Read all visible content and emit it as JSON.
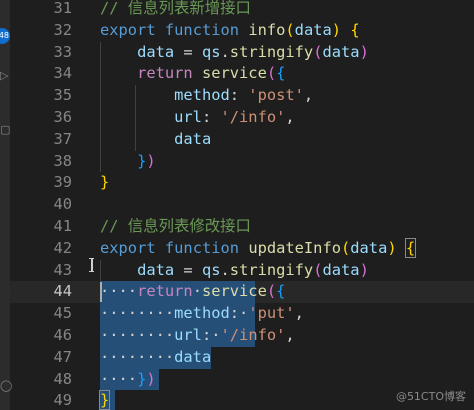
{
  "activity_bar": {
    "badge": "48",
    "icons": [
      "run-debug-icon",
      "extensions-icon",
      "account-icon"
    ]
  },
  "editor": {
    "current_line": 44,
    "lines": [
      {
        "number": "31",
        "tokens": [
          {
            "t": "// 信息列表新增接口",
            "c": "cmt"
          }
        ]
      },
      {
        "number": "32",
        "tokens": [
          {
            "t": "export",
            "c": "kw"
          },
          {
            "t": " "
          },
          {
            "t": "function",
            "c": "kw"
          },
          {
            "t": " "
          },
          {
            "t": "info",
            "c": "fn"
          },
          {
            "t": "(",
            "c": "b1"
          },
          {
            "t": "data",
            "c": "vr"
          },
          {
            "t": ")",
            "c": "b1"
          },
          {
            "t": " "
          },
          {
            "t": "{",
            "c": "b1"
          }
        ]
      },
      {
        "number": "33",
        "tokens": [
          {
            "t": "    "
          },
          {
            "t": "data",
            "c": "vr"
          },
          {
            "t": " = "
          },
          {
            "t": "qs",
            "c": "vr"
          },
          {
            "t": "."
          },
          {
            "t": "stringify",
            "c": "fn"
          },
          {
            "t": "(",
            "c": "b2"
          },
          {
            "t": "data",
            "c": "vr"
          },
          {
            "t": ")",
            "c": "b2"
          }
        ]
      },
      {
        "number": "34",
        "tokens": [
          {
            "t": "    "
          },
          {
            "t": "return",
            "c": "ctl"
          },
          {
            "t": " "
          },
          {
            "t": "service",
            "c": "fn"
          },
          {
            "t": "(",
            "c": "b2"
          },
          {
            "t": "{",
            "c": "b3"
          }
        ]
      },
      {
        "number": "35",
        "tokens": [
          {
            "t": "        "
          },
          {
            "t": "method",
            "c": "vr"
          },
          {
            "t": ": "
          },
          {
            "t": "'post'",
            "c": "str"
          },
          {
            "t": ","
          }
        ]
      },
      {
        "number": "36",
        "tokens": [
          {
            "t": "        "
          },
          {
            "t": "url",
            "c": "vr"
          },
          {
            "t": ": "
          },
          {
            "t": "'/info'",
            "c": "str"
          },
          {
            "t": ","
          }
        ]
      },
      {
        "number": "37",
        "tokens": [
          {
            "t": "        "
          },
          {
            "t": "data",
            "c": "vr"
          }
        ]
      },
      {
        "number": "38",
        "tokens": [
          {
            "t": "    "
          },
          {
            "t": "}",
            "c": "b3"
          },
          {
            "t": ")",
            "c": "b2"
          }
        ]
      },
      {
        "number": "39",
        "tokens": [
          {
            "t": "}",
            "c": "b1"
          }
        ]
      },
      {
        "number": "40",
        "tokens": []
      },
      {
        "number": "41",
        "tokens": [
          {
            "t": "// 信息列表修改接口",
            "c": "cmt"
          }
        ]
      },
      {
        "number": "42",
        "tokens": [
          {
            "t": "export",
            "c": "kw"
          },
          {
            "t": " "
          },
          {
            "t": "function",
            "c": "kw"
          },
          {
            "t": " "
          },
          {
            "t": "updateInfo",
            "c": "fn"
          },
          {
            "t": "(",
            "c": "b1"
          },
          {
            "t": "data",
            "c": "vr"
          },
          {
            "t": ")",
            "c": "b1"
          },
          {
            "t": " "
          },
          {
            "t": "{",
            "c": "b1",
            "m": true
          }
        ]
      },
      {
        "number": "43",
        "tokens": [
          {
            "t": "    "
          },
          {
            "t": "data",
            "c": "vr"
          },
          {
            "t": " = "
          },
          {
            "t": "qs",
            "c": "vr"
          },
          {
            "t": "."
          },
          {
            "t": "stringify",
            "c": "fn"
          },
          {
            "t": "(",
            "c": "b2"
          },
          {
            "t": "data",
            "c": "vr"
          },
          {
            "t": ")",
            "c": "b2"
          }
        ]
      },
      {
        "number": "44",
        "tokens": [
          {
            "t": "    ",
            "w": true
          },
          {
            "t": "return",
            "c": "ctl"
          },
          {
            "t": " ",
            "w": true
          },
          {
            "t": "service",
            "c": "fn"
          },
          {
            "t": "(",
            "c": "b2"
          },
          {
            "t": "{",
            "c": "b3"
          }
        ]
      },
      {
        "number": "45",
        "tokens": [
          {
            "t": "        ",
            "w": true
          },
          {
            "t": "method",
            "c": "vr"
          },
          {
            "t": ":"
          },
          {
            "t": " ",
            "w": true
          },
          {
            "t": "'put'",
            "c": "str"
          },
          {
            "t": ","
          }
        ]
      },
      {
        "number": "46",
        "tokens": [
          {
            "t": "        ",
            "w": true
          },
          {
            "t": "url",
            "c": "vr"
          },
          {
            "t": ":"
          },
          {
            "t": " ",
            "w": true
          },
          {
            "t": "'/info'",
            "c": "str"
          },
          {
            "t": ","
          }
        ]
      },
      {
        "number": "47",
        "tokens": [
          {
            "t": "        ",
            "w": true
          },
          {
            "t": "data",
            "c": "vr"
          }
        ]
      },
      {
        "number": "48",
        "tokens": [
          {
            "t": "    ",
            "w": true
          },
          {
            "t": "}",
            "c": "b3"
          },
          {
            "t": ")",
            "c": "b2"
          }
        ]
      },
      {
        "number": "49",
        "tokens": [
          {
            "t": "}",
            "c": "b1",
            "m": true
          }
        ]
      }
    ]
  },
  "selection": {
    "from_line": "44",
    "to_line": "49",
    "columns": [
      {
        "line": "44",
        "chars": 17
      },
      {
        "line": "45",
        "chars": 17
      },
      {
        "line": "46",
        "chars": 17
      },
      {
        "line": "47",
        "chars": 12
      },
      {
        "line": "48",
        "chars": 6
      },
      {
        "line": "49",
        "chars": 1
      }
    ]
  },
  "watermark": "@51CTO博客",
  "colors": {
    "background": "#1e1e1e",
    "selection": "#264f78",
    "comment": "#6a9955",
    "keyword": "#569cd6",
    "control": "#c586c0",
    "function": "#dcdcaa",
    "variable": "#9cdcfe",
    "string": "#ce9178"
  }
}
